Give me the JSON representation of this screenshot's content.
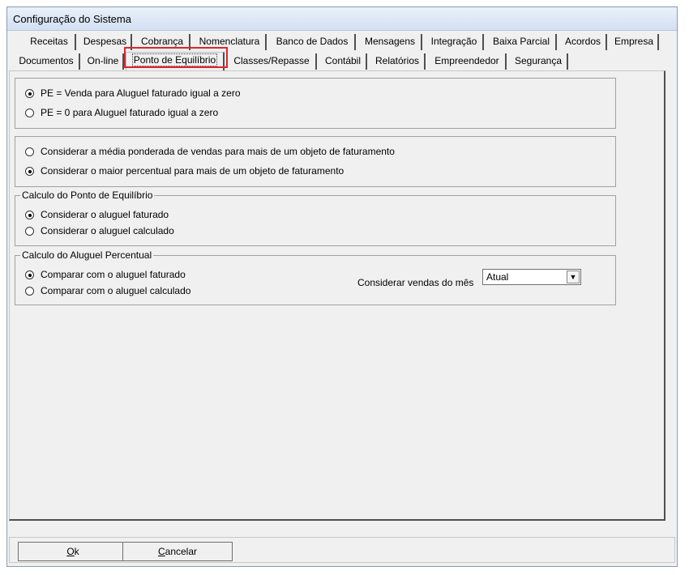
{
  "window": {
    "title": "Configuração do Sistema"
  },
  "tabs": {
    "row1": [
      "Receitas",
      "Despesas",
      "Cobrança",
      "Nomenclatura",
      "Banco de Dados",
      "Mensagens",
      "Integração",
      "Baixa Parcial",
      "Acordos",
      "Empresa"
    ],
    "row2": [
      "Documentos",
      "On-line",
      "Ponto de Equilíbrio",
      "Classes/Repasse",
      "Contábil",
      "Relatórios",
      "Empreendedor",
      "Segurança"
    ],
    "active": "Ponto de Equilíbrio"
  },
  "group1": {
    "opt1": "PE = Venda para Aluguel faturado igual a zero",
    "opt2": "PE = 0 para Aluguel faturado igual a zero",
    "selected": 1
  },
  "group2": {
    "opt1": "Considerar a média ponderada de vendas para mais de um objeto de faturamento",
    "opt2": "Considerar o maior percentual para mais de um objeto de faturamento",
    "selected": 2
  },
  "group3": {
    "legend": "Calculo do Ponto de Equilíbrio",
    "opt1": "Considerar o aluguel faturado",
    "opt2": "Considerar o aluguel calculado",
    "selected": 1
  },
  "group4": {
    "legend": "Calculo do Aluguel Percentual",
    "opt1": "Comparar com o aluguel faturado",
    "opt2": "Comparar com o aluguel calculado",
    "selected": 1,
    "select_label": "Considerar vendas do mês",
    "select_value": "Atual"
  },
  "buttons": {
    "ok_key": "O",
    "ok_rest": "k",
    "cancel_key": "C",
    "cancel_rest": "ancelar"
  }
}
